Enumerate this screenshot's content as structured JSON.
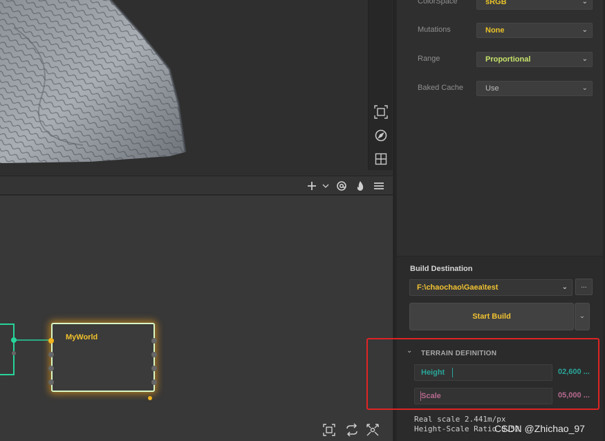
{
  "properties": {
    "rows": [
      {
        "label": "ColorSpace",
        "value": "sRGB",
        "style": "yellow"
      },
      {
        "label": "Mutations",
        "value": "None",
        "style": "yellow"
      },
      {
        "label": "Range",
        "value": "Proportional",
        "style": "green"
      },
      {
        "label": "Baked Cache",
        "value": "Use",
        "style": "gray"
      }
    ]
  },
  "build": {
    "destination_label": "Build Destination",
    "destination_path": "F:\\chaochao\\Gaea\\test",
    "browse_label": "...",
    "start_label": "Start Build"
  },
  "terrain_definition": {
    "title": "TERRAIN DEFINITION",
    "height_label": "Height",
    "height_value": "02,600 ...",
    "scale_label": "Scale",
    "scale_value": "05,000 ...",
    "real_scale": "Real scale 2.441m/px",
    "height_scale_ratio": "Height-Scale Ratio 0.52"
  },
  "graph": {
    "node_title": "MyWorld"
  },
  "icons": {
    "viewport_tools": [
      "frame-select-icon",
      "compass-icon",
      "grid-view-icon"
    ],
    "graph_toolbar": [
      "add-icon",
      "chevron-down-icon",
      "at-icon",
      "flame-icon",
      "menu-icon"
    ],
    "graph_bottom": [
      "fit-view-icon",
      "refresh-icon",
      "auto-arrange-icon"
    ]
  },
  "colors": {
    "accent_yellow": "#f1c232",
    "teal": "#28a69a",
    "pink": "#b7698f",
    "node_border": "#d7f7c5",
    "link_green": "#27d49a",
    "highlight_red": "#e02424"
  },
  "watermark": "CSDN @Zhichao_97"
}
